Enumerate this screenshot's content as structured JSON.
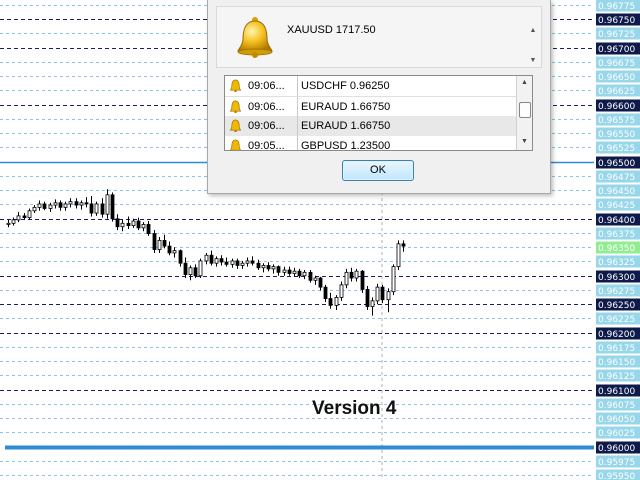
{
  "chart": {
    "price_labels": [
      "0.96775",
      "0.96750",
      "0.96725",
      "0.96700",
      "0.96675",
      "0.96650",
      "0.96625",
      "0.96600",
      "0.96575",
      "0.96550",
      "0.96525",
      "0.96500",
      "0.96475",
      "0.96450",
      "0.96425",
      "0.96400",
      "0.96375",
      "0.96350",
      "0.96325",
      "0.96300",
      "0.96275",
      "0.96250",
      "0.96225",
      "0.96200",
      "0.96175",
      "0.96150",
      "0.96125",
      "0.96100",
      "0.96075",
      "0.96050",
      "0.96025",
      "0.96000",
      "0.95975",
      "0.95950"
    ],
    "highlighted_levels": [
      "0.96750",
      "0.96700",
      "0.96600",
      "0.96500",
      "0.96400",
      "0.96300",
      "0.96250",
      "0.96200",
      "0.96100",
      "0.96000"
    ],
    "current_price": "0.96350",
    "candles": [
      [
        0.9639,
        0.96398,
        0.96385,
        0.96392
      ],
      [
        0.96392,
        0.96402,
        0.96388,
        0.96398
      ],
      [
        0.96398,
        0.96412,
        0.96394,
        0.96405
      ],
      [
        0.96405,
        0.9641,
        0.96398,
        0.96402
      ],
      [
        0.96402,
        0.96418,
        0.96398,
        0.96414
      ],
      [
        0.96414,
        0.96424,
        0.9641,
        0.9642
      ],
      [
        0.9642,
        0.96432,
        0.96414,
        0.96426
      ],
      [
        0.96426,
        0.9643,
        0.96415,
        0.96418
      ],
      [
        0.96418,
        0.96428,
        0.96412,
        0.96424
      ],
      [
        0.96424,
        0.96434,
        0.96418,
        0.96428
      ],
      [
        0.96428,
        0.96432,
        0.96414,
        0.9642
      ],
      [
        0.9642,
        0.9643,
        0.96414,
        0.96426
      ],
      [
        0.96426,
        0.96436,
        0.9642,
        0.9643
      ],
      [
        0.9643,
        0.96436,
        0.96418,
        0.96424
      ],
      [
        0.96424,
        0.96432,
        0.96416,
        0.96428
      ],
      [
        0.96428,
        0.96438,
        0.9642,
        0.96426
      ],
      [
        0.96426,
        0.9644,
        0.96404,
        0.9641
      ],
      [
        0.9641,
        0.9643,
        0.96405,
        0.96426
      ],
      [
        0.96426,
        0.96436,
        0.96402,
        0.96408
      ],
      [
        0.96408,
        0.96452,
        0.964,
        0.96442
      ],
      [
        0.96442,
        0.96446,
        0.96395,
        0.964
      ],
      [
        0.964,
        0.96408,
        0.9638,
        0.96386
      ],
      [
        0.96386,
        0.96398,
        0.96378,
        0.96392
      ],
      [
        0.96392,
        0.96404,
        0.96382,
        0.96388
      ],
      [
        0.96388,
        0.964,
        0.96384,
        0.96396
      ],
      [
        0.96396,
        0.96402,
        0.9638,
        0.96384
      ],
      [
        0.96384,
        0.96394,
        0.96378,
        0.9639
      ],
      [
        0.9639,
        0.96396,
        0.9637,
        0.96374
      ],
      [
        0.96374,
        0.9638,
        0.9634,
        0.96346
      ],
      [
        0.96346,
        0.96368,
        0.9634,
        0.96362
      ],
      [
        0.96362,
        0.96372,
        0.96348,
        0.96352
      ],
      [
        0.96352,
        0.9636,
        0.96336,
        0.9634
      ],
      [
        0.9634,
        0.9635,
        0.96332,
        0.96344
      ],
      [
        0.96344,
        0.96346,
        0.96316,
        0.96322
      ],
      [
        0.96322,
        0.96332,
        0.96296,
        0.96302
      ],
      [
        0.96302,
        0.96318,
        0.96292,
        0.96314
      ],
      [
        0.96314,
        0.9632,
        0.96296,
        0.963
      ],
      [
        0.963,
        0.9633,
        0.96296,
        0.96326
      ],
      [
        0.96326,
        0.9634,
        0.9632,
        0.96336
      ],
      [
        0.96336,
        0.96344,
        0.96318,
        0.96322
      ],
      [
        0.96322,
        0.96334,
        0.96316,
        0.9633
      ],
      [
        0.9633,
        0.96336,
        0.96318,
        0.96324
      ],
      [
        0.96324,
        0.96332,
        0.96316,
        0.9632
      ],
      [
        0.9632,
        0.9633,
        0.96314,
        0.96326
      ],
      [
        0.96326,
        0.9633,
        0.96312,
        0.96318
      ],
      [
        0.96318,
        0.96326,
        0.96312,
        0.96322
      ],
      [
        0.96322,
        0.96332,
        0.96316,
        0.96326
      ],
      [
        0.96326,
        0.96334,
        0.96318,
        0.96322
      ],
      [
        0.96322,
        0.96328,
        0.9631,
        0.96314
      ],
      [
        0.96314,
        0.96322,
        0.96306,
        0.96318
      ],
      [
        0.96318,
        0.96324,
        0.96308,
        0.96312
      ],
      [
        0.96312,
        0.9632,
        0.96304,
        0.96316
      ],
      [
        0.96316,
        0.96318,
        0.963,
        0.96306
      ],
      [
        0.96306,
        0.96316,
        0.963,
        0.9631
      ],
      [
        0.9631,
        0.96316,
        0.963,
        0.96304
      ],
      [
        0.96304,
        0.96314,
        0.96298,
        0.96308
      ],
      [
        0.96308,
        0.96312,
        0.96296,
        0.963
      ],
      [
        0.963,
        0.9631,
        0.96294,
        0.96306
      ],
      [
        0.96306,
        0.9631,
        0.96288,
        0.96292
      ],
      [
        0.96292,
        0.963,
        0.96284,
        0.96296
      ],
      [
        0.96296,
        0.96298,
        0.96274,
        0.9628
      ],
      [
        0.9628,
        0.96284,
        0.96254,
        0.9626
      ],
      [
        0.9626,
        0.9627,
        0.96242,
        0.96248
      ],
      [
        0.96248,
        0.96266,
        0.9624,
        0.96262
      ],
      [
        0.96262,
        0.9629,
        0.96256,
        0.96284
      ],
      [
        0.96284,
        0.96312,
        0.96278,
        0.96306
      ],
      [
        0.96306,
        0.96314,
        0.9629,
        0.96296
      ],
      [
        0.96296,
        0.96312,
        0.9629,
        0.96308
      ],
      [
        0.96308,
        0.9631,
        0.9627,
        0.96276
      ],
      [
        0.96276,
        0.96282,
        0.9624,
        0.96246
      ],
      [
        0.96246,
        0.96262,
        0.9623,
        0.96256
      ],
      [
        0.96256,
        0.96286,
        0.9625,
        0.9628
      ],
      [
        0.9628,
        0.96284,
        0.96252,
        0.96258
      ],
      [
        0.96258,
        0.96278,
        0.96236,
        0.96272
      ],
      [
        0.96272,
        0.9632,
        0.96266,
        0.96316
      ],
      [
        0.96316,
        0.96362,
        0.9631,
        0.96356
      ],
      [
        0.96356,
        0.96362,
        0.96342,
        0.96352
      ]
    ]
  },
  "watermark": "Version 4",
  "dialog": {
    "symbol_message": "XAUUSD 1717.50",
    "rows": [
      {
        "time": "09:06...",
        "text": "USDCHF 0.96250"
      },
      {
        "time": "09:06...",
        "text": "EURAUD 1.66750"
      },
      {
        "time": "09:06...",
        "text": "EURAUD 1.66750"
      },
      {
        "time": "09:05...",
        "text": "GBPUSD 1.23500"
      }
    ],
    "ok_label": "OK"
  },
  "colors": {
    "bright_level": "#2f8bd6",
    "dark_level": "#1a1a6e",
    "cyan_level": "#86c8e6",
    "axis_label_bg": "#98d6ea",
    "axis_label_highlight_bg": "#0d1a4a",
    "current_price_bg": "#90ee90"
  }
}
